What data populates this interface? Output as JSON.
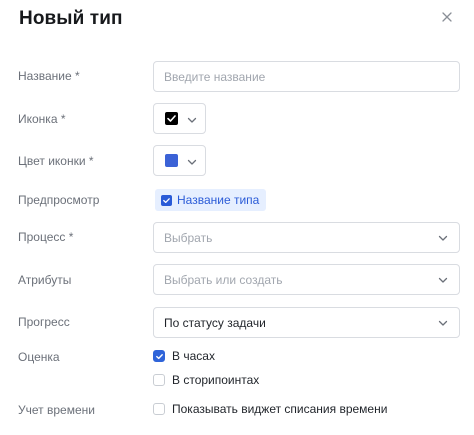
{
  "dialog": {
    "title": "Новый тип",
    "close_icon": "close-icon"
  },
  "fields": {
    "name": {
      "label": "Название *",
      "placeholder": "Введите название"
    },
    "icon": {
      "label": "Иконка *",
      "icon_name": "checkbox-icon",
      "color": "#000000"
    },
    "icon_color": {
      "label": "Цвет иконки *",
      "color": "#3b62d6"
    },
    "preview": {
      "label": "Предпросмотр",
      "text": "Название типа",
      "accent": "#2a5bd7",
      "background": "#e6efff"
    },
    "process": {
      "label": "Процесс *",
      "placeholder": "Выбрать"
    },
    "attributes": {
      "label": "Атрибуты",
      "placeholder": "Выбрать или создать"
    },
    "progress": {
      "label": "Прогресс",
      "value": "По статусу задачи"
    },
    "estimate": {
      "label": "Оценка",
      "options": [
        {
          "label": "В часах",
          "checked": true
        },
        {
          "label": "В сторипоинтах",
          "checked": false
        }
      ]
    },
    "time_tracking": {
      "label": "Учет времени",
      "option": {
        "label": "Показывать виджет списания времени",
        "checked": false
      }
    }
  }
}
